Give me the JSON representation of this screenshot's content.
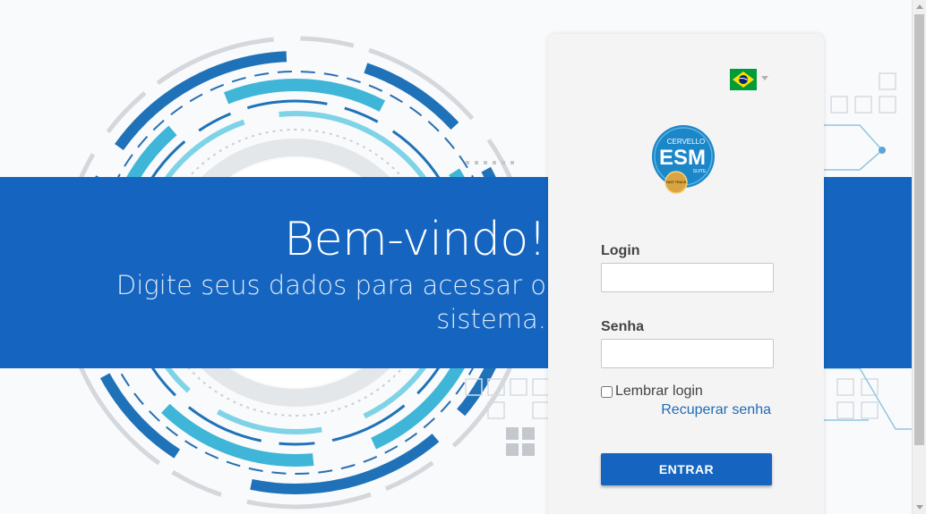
{
  "hero": {
    "title": "Bem-vindo!",
    "subtitle": "Digite seus dados para acessar o sistema."
  },
  "login_card": {
    "language": {
      "icon": "brazil-flag-icon",
      "caret_icon": "caret-down-icon"
    },
    "logo": {
      "brand": "CERVELLO",
      "product": "ESM",
      "suite": "SUITE",
      "badge": "FAST TRACK"
    },
    "login_label": "Login",
    "login_value": "",
    "password_label": "Senha",
    "password_value": "",
    "remember_label": "Lembrar login",
    "remember_checked": false,
    "recover_link": "Recuperar senha",
    "submit_label": "ENTRAR"
  },
  "colors": {
    "primary": "#1565c0",
    "accent": "#3fb5d8",
    "link": "#1e6bb8",
    "card_bg": "#f4f4f4"
  }
}
